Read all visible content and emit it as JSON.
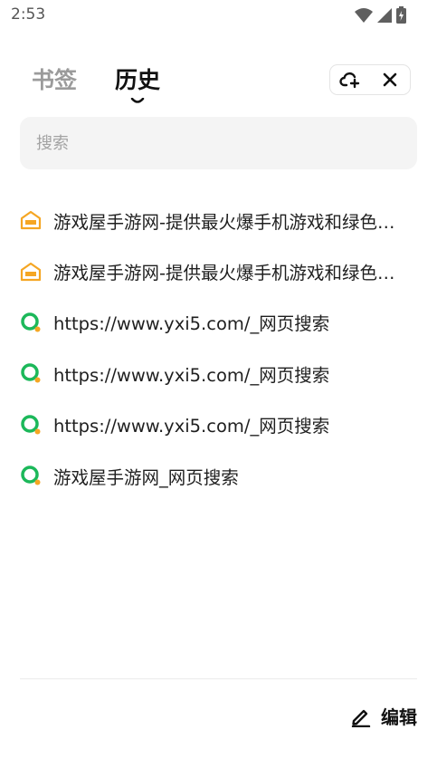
{
  "status_bar": {
    "time": "2:53"
  },
  "header": {
    "tabs": [
      {
        "label": "书签",
        "active": false
      },
      {
        "label": "历史",
        "active": true
      }
    ]
  },
  "search": {
    "placeholder": "搜索",
    "value": ""
  },
  "history": {
    "items": [
      {
        "title": "游戏屋手游网-提供最火爆手机游戏和绿色手游下载",
        "icon": "house-favicon-icon"
      },
      {
        "title": "游戏屋手游网-提供最火爆手机游戏和绿色手游下载",
        "icon": "house-favicon-icon"
      },
      {
        "title": "https://www.yxi5.com/_网页搜索",
        "icon": "search-ring-favicon-icon"
      },
      {
        "title": "https://www.yxi5.com/_网页搜索",
        "icon": "search-ring-favicon-icon"
      },
      {
        "title": "https://www.yxi5.com/_网页搜索",
        "icon": "search-ring-favicon-icon"
      },
      {
        "title": "游戏屋手游网_网页搜索",
        "icon": "search-ring-favicon-icon"
      }
    ]
  },
  "footer": {
    "edit_label": "编辑"
  },
  "colors": {
    "favicon_orange": "#f5a623",
    "ring_green": "#1cb85a",
    "ring_orange": "#f5a623",
    "inactive_tab": "#9b9b9b"
  }
}
